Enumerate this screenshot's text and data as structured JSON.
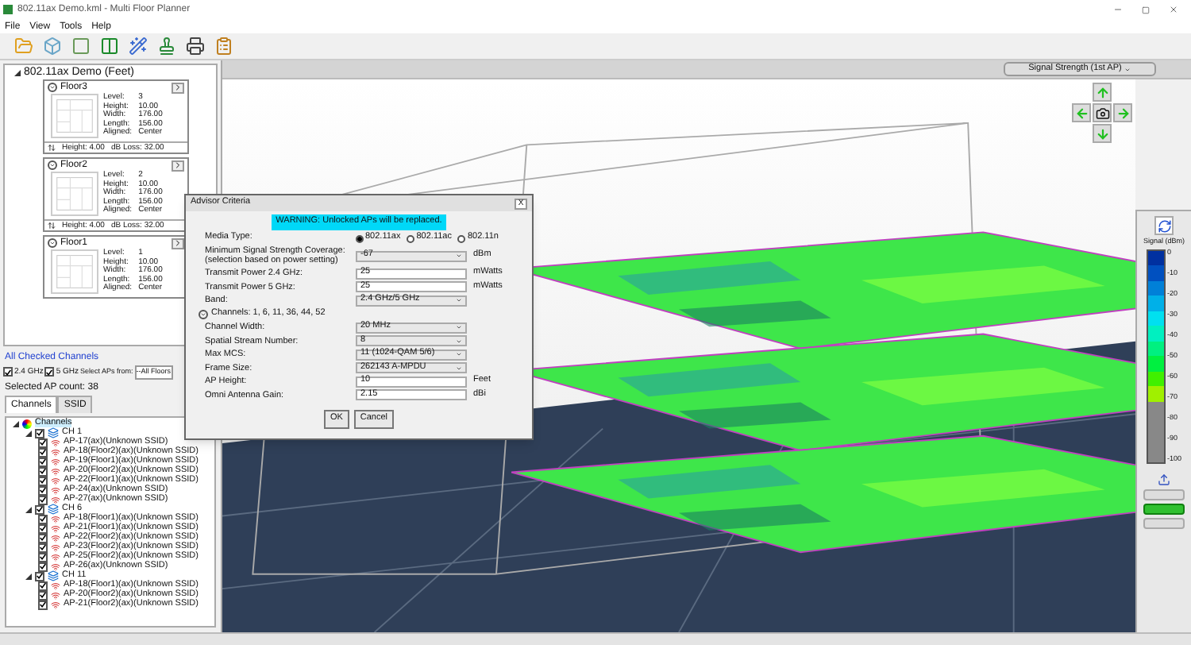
{
  "window": {
    "title": "802.11ax Demo.kml - Multi Floor Planner"
  },
  "menu": [
    "File",
    "View",
    "Tools",
    "Help"
  ],
  "project": {
    "title": "802.11ax Demo (Feet)",
    "expanded": true
  },
  "floors": [
    {
      "name": "Floor3",
      "props": [
        {
          "label": "Level:",
          "value": "3"
        },
        {
          "label": "Height:",
          "value": "10.00"
        },
        {
          "label": "Width:",
          "value": "176.00"
        },
        {
          "label": "Length:",
          "value": "156.00"
        },
        {
          "label": "Aligned:",
          "value": "Center"
        }
      ],
      "gap": "Height: 4.00",
      "loss": "dB Loss: 32.00"
    },
    {
      "name": "Floor2",
      "props": [
        {
          "label": "Level:",
          "value": "2"
        },
        {
          "label": "Height:",
          "value": "10.00"
        },
        {
          "label": "Width:",
          "value": "176.00"
        },
        {
          "label": "Length:",
          "value": "156.00"
        },
        {
          "label": "Aligned:",
          "value": "Center"
        }
      ],
      "gap": "Height: 4.00",
      "loss": "dB Loss: 32.00"
    },
    {
      "name": "Floor1",
      "props": [
        {
          "label": "Level:",
          "value": "1"
        },
        {
          "label": "Height:",
          "value": "10.00"
        },
        {
          "label": "Width:",
          "value": "176.00"
        },
        {
          "label": "Length:",
          "value": "156.00"
        },
        {
          "label": "Aligned:",
          "value": "Center"
        }
      ]
    }
  ],
  "channels_panel": {
    "link": "All Checked Channels",
    "bands": [
      {
        "label": "2.4 GHz",
        "checked": true
      },
      {
        "label": "5 GHz",
        "checked": true
      }
    ],
    "select_label": "Select APs from:",
    "select_value": "--All Floors",
    "count": "Selected AP count: 38",
    "tabs": [
      {
        "label": "Channels",
        "selected": true
      },
      {
        "label": "SSID",
        "selected": false
      }
    ],
    "tree": [
      {
        "kind": "root",
        "label": "Channels",
        "selected": true,
        "expanded": true,
        "children": [
          {
            "kind": "channel",
            "label": "CH 1",
            "selected": false,
            "checked": true,
            "expanded": true,
            "children": [
              {
                "kind": "ap",
                "label": "AP-17(ax)(Unknown SSID)",
                "selected": false,
                "checked": true
              },
              {
                "kind": "ap",
                "label": "AP-18(Floor2)(ax)(Unknown SSID)",
                "selected": false,
                "checked": true
              },
              {
                "kind": "ap",
                "label": "AP-19(Floor1)(ax)(Unknown SSID)",
                "selected": false,
                "checked": true
              },
              {
                "kind": "ap",
                "label": "AP-20(Floor2)(ax)(Unknown SSID)",
                "selected": false,
                "checked": true
              },
              {
                "kind": "ap",
                "label": "AP-22(Floor1)(ax)(Unknown SSID)",
                "selected": false,
                "checked": true
              },
              {
                "kind": "ap",
                "label": "AP-24(ax)(Unknown SSID)",
                "selected": false,
                "checked": true
              },
              {
                "kind": "ap",
                "label": "AP-27(ax)(Unknown SSID)",
                "selected": false,
                "checked": true
              }
            ]
          },
          {
            "kind": "channel",
            "label": "CH 6",
            "selected": false,
            "checked": true,
            "expanded": true,
            "children": [
              {
                "kind": "ap",
                "label": "AP-18(Floor1)(ax)(Unknown SSID)",
                "selected": false,
                "checked": true
              },
              {
                "kind": "ap",
                "label": "AP-21(Floor1)(ax)(Unknown SSID)",
                "selected": false,
                "checked": true
              },
              {
                "kind": "ap",
                "label": "AP-22(Floor2)(ax)(Unknown SSID)",
                "selected": false,
                "checked": true
              },
              {
                "kind": "ap",
                "label": "AP-23(Floor2)(ax)(Unknown SSID)",
                "selected": false,
                "checked": true
              },
              {
                "kind": "ap",
                "label": "AP-25(Floor2)(ax)(Unknown SSID)",
                "selected": false,
                "checked": true
              },
              {
                "kind": "ap",
                "label": "AP-26(ax)(Unknown SSID)",
                "selected": false,
                "checked": true
              }
            ]
          },
          {
            "kind": "channel",
            "label": "CH 11",
            "selected": false,
            "checked": true,
            "expanded": true,
            "children": [
              {
                "kind": "ap",
                "label": "AP-18(Floor1)(ax)(Unknown SSID)",
                "selected": false,
                "checked": true
              },
              {
                "kind": "ap",
                "label": "AP-20(Floor2)(ax)(Unknown SSID)",
                "selected": false,
                "checked": true
              },
              {
                "kind": "ap",
                "label": "AP-21(Floor2)(ax)(Unknown SSID)",
                "selected": false,
                "checked": true
              }
            ]
          }
        ]
      }
    ]
  },
  "view": {
    "mode_select": "Signal Strength (1st AP)"
  },
  "legend": {
    "title": "Signal (dBm)",
    "ticks": [
      "0",
      "-10",
      "-20",
      "-30",
      "-40",
      "-50",
      "-60",
      "-70",
      "-80",
      "-90",
      "-100"
    ],
    "buttons": [
      {
        "selected": false
      },
      {
        "selected": true
      },
      {
        "selected": false
      }
    ]
  },
  "dialog": {
    "title": "Advisor Criteria",
    "close": "X",
    "warning": "WARNING: Unlocked APs will be replaced.",
    "media_label": "Media Type:",
    "media": [
      {
        "label": "802.11ax",
        "selected": true
      },
      {
        "label": "802.11ac",
        "selected": false
      },
      {
        "label": "802.11n",
        "selected": false
      }
    ],
    "rows": [
      {
        "kind": "select",
        "label": "Minimum Signal Strength Coverage:",
        "note": "(selection based on power setting)",
        "value": "-67",
        "unit": "dBm"
      },
      {
        "kind": "input",
        "label": "Transmit Power 2.4 GHz:",
        "value": "25",
        "unit": "mWatts"
      },
      {
        "kind": "input",
        "label": "Transmit Power 5 GHz:",
        "value": "25",
        "unit": "mWatts"
      },
      {
        "kind": "select",
        "label": "Band:",
        "value": "2.4 GHz/5 GHz"
      },
      {
        "kind": "expander",
        "label": "Channels: 1, 6, 11, 36, 44, 52"
      },
      {
        "kind": "select",
        "label": "Channel Width:",
        "value": "20 MHz"
      },
      {
        "kind": "select",
        "label": "Spatial Stream Number:",
        "value": "8"
      },
      {
        "kind": "select",
        "label": "Max MCS:",
        "value": "11 (1024-QAM 5/6)"
      },
      {
        "kind": "select",
        "label": "Frame Size:",
        "value": "262143 A-MPDU"
      },
      {
        "kind": "input",
        "label": "AP Height:",
        "value": "10",
        "unit": "Feet"
      },
      {
        "kind": "input",
        "label": "Omni Antenna Gain:",
        "value": "2.15",
        "unit": "dBi"
      }
    ],
    "buttons": [
      "OK",
      "Cancel"
    ]
  }
}
